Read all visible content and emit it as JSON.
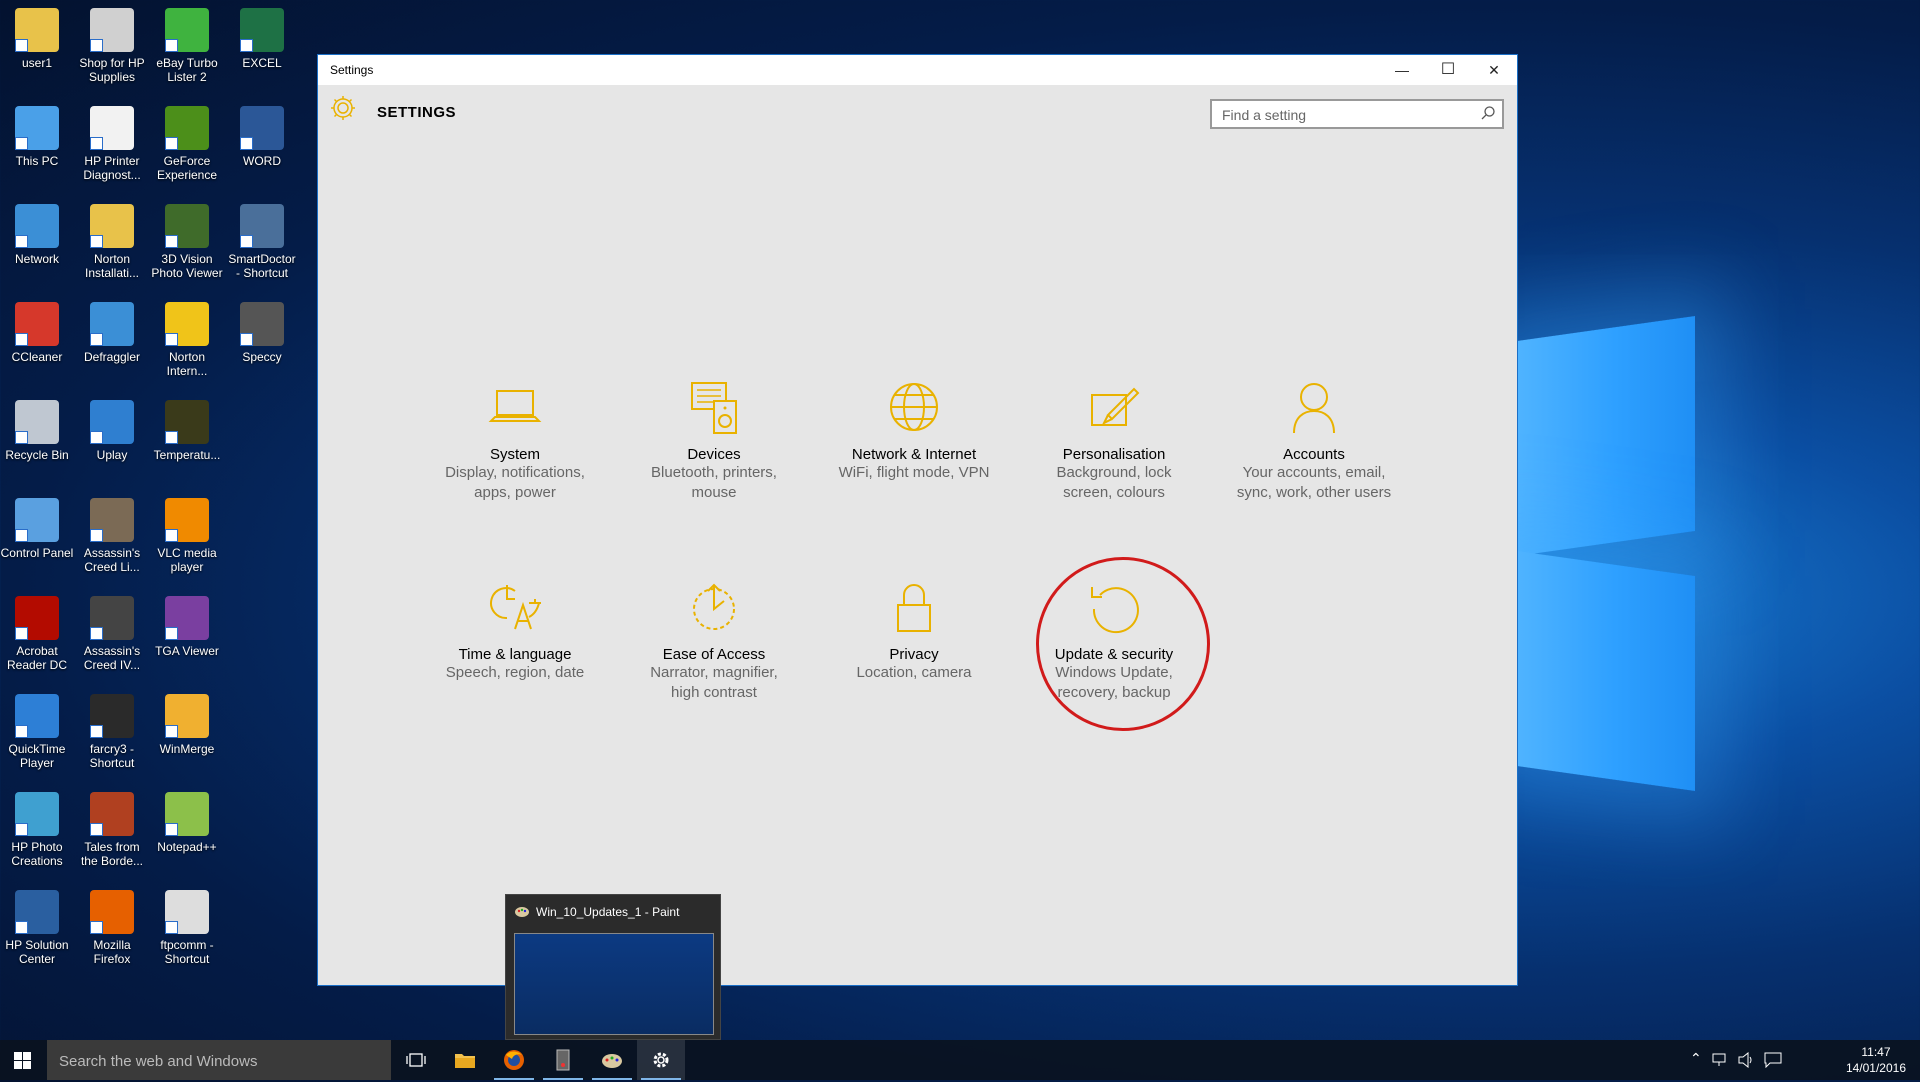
{
  "desktop": {
    "icons": [
      {
        "label": "user1",
        "color": "#e8c24a"
      },
      {
        "label": "Shop for HP Supplies",
        "color": "#d0d0d0"
      },
      {
        "label": "eBay Turbo Lister 2",
        "color": "#3fb33f"
      },
      {
        "label": "EXCEL",
        "color": "#1e7145"
      },
      {
        "label": "This PC",
        "color": "#4aa0e8"
      },
      {
        "label": "HP Printer Diagnost...",
        "color": "#f2f2f2"
      },
      {
        "label": "GeForce Experience",
        "color": "#4c8f1a"
      },
      {
        "label": "WORD",
        "color": "#2b5797"
      },
      {
        "label": "Network",
        "color": "#3b8fd6"
      },
      {
        "label": "Norton Installati...",
        "color": "#e8c24a"
      },
      {
        "label": "3D Vision Photo Viewer",
        "color": "#3f6b2a"
      },
      {
        "label": "SmartDoctor - Shortcut",
        "color": "#4a6f9a"
      },
      {
        "label": "CCleaner",
        "color": "#d6382b"
      },
      {
        "label": "Defraggler",
        "color": "#3b8fd6"
      },
      {
        "label": "Norton Intern...",
        "color": "#f0c419"
      },
      {
        "label": "Speccy",
        "color": "#555555"
      },
      {
        "label": "Recycle Bin",
        "color": "#bfc7d1"
      },
      {
        "label": "Uplay",
        "color": "#2f7fd0"
      },
      {
        "label": "Temperatu...",
        "color": "#3a3a1a"
      },
      {
        "label": "Control Panel",
        "color": "#5aa0e0"
      },
      {
        "label": "Assassin's Creed Li...",
        "color": "#7b6a55"
      },
      {
        "label": "VLC media player",
        "color": "#f08a00"
      },
      {
        "label": "Acrobat Reader DC",
        "color": "#b30b00"
      },
      {
        "label": "Assassin's Creed IV...",
        "color": "#444444"
      },
      {
        "label": "TGA Viewer",
        "color": "#7a3fa0"
      },
      {
        "label": "QuickTime Player",
        "color": "#2d7fd6"
      },
      {
        "label": "farcry3 - Shortcut",
        "color": "#2a2a2a"
      },
      {
        "label": "WinMerge",
        "color": "#f0b030"
      },
      {
        "label": "HP Photo Creations",
        "color": "#3fa0d0"
      },
      {
        "label": "Tales from the Borde...",
        "color": "#b04020"
      },
      {
        "label": "Notepad++",
        "color": "#8cc04a"
      },
      {
        "label": "HP Solution Center",
        "color": "#2a5fa0"
      },
      {
        "label": "Mozilla Firefox",
        "color": "#e66000"
      },
      {
        "label": "ftpcomm - Shortcut",
        "color": "#dddddd"
      }
    ]
  },
  "window": {
    "title": "Settings",
    "minimize": "—",
    "maximize": "☐",
    "close": "✕",
    "header_title": "SETTINGS",
    "search_placeholder": "Find a setting",
    "accent": "#e9b200"
  },
  "tiles": [
    {
      "name": "System",
      "desc1": "Display, notifications,",
      "desc2": "apps, power",
      "icon": "laptop-icon"
    },
    {
      "name": "Devices",
      "desc1": "Bluetooth, printers,",
      "desc2": "mouse",
      "icon": "devices-icon"
    },
    {
      "name": "Network & Internet",
      "desc1": "WiFi, flight mode, VPN",
      "desc2": "",
      "icon": "globe-icon"
    },
    {
      "name": "Personalisation",
      "desc1": "Background, lock",
      "desc2": "screen, colours",
      "icon": "paint-icon"
    },
    {
      "name": "Accounts",
      "desc1": "Your accounts, email,",
      "desc2": "sync, work, other users",
      "icon": "person-icon"
    },
    {
      "name": "Time & language",
      "desc1": "Speech, region, date",
      "desc2": "",
      "icon": "time-language-icon"
    },
    {
      "name": "Ease of Access",
      "desc1": "Narrator, magnifier,",
      "desc2": "high contrast",
      "icon": "ease-of-access-icon"
    },
    {
      "name": "Privacy",
      "desc1": "Location, camera",
      "desc2": "",
      "icon": "lock-icon"
    },
    {
      "name": "Update & security",
      "desc1": "Windows Update,",
      "desc2": "recovery, backup",
      "icon": "refresh-icon"
    }
  ],
  "preview": {
    "title": "Win_10_Updates_1 - Paint"
  },
  "taskbar": {
    "search_placeholder": "Search the web and Windows",
    "time": "11:47",
    "date": "14/01/2016"
  }
}
